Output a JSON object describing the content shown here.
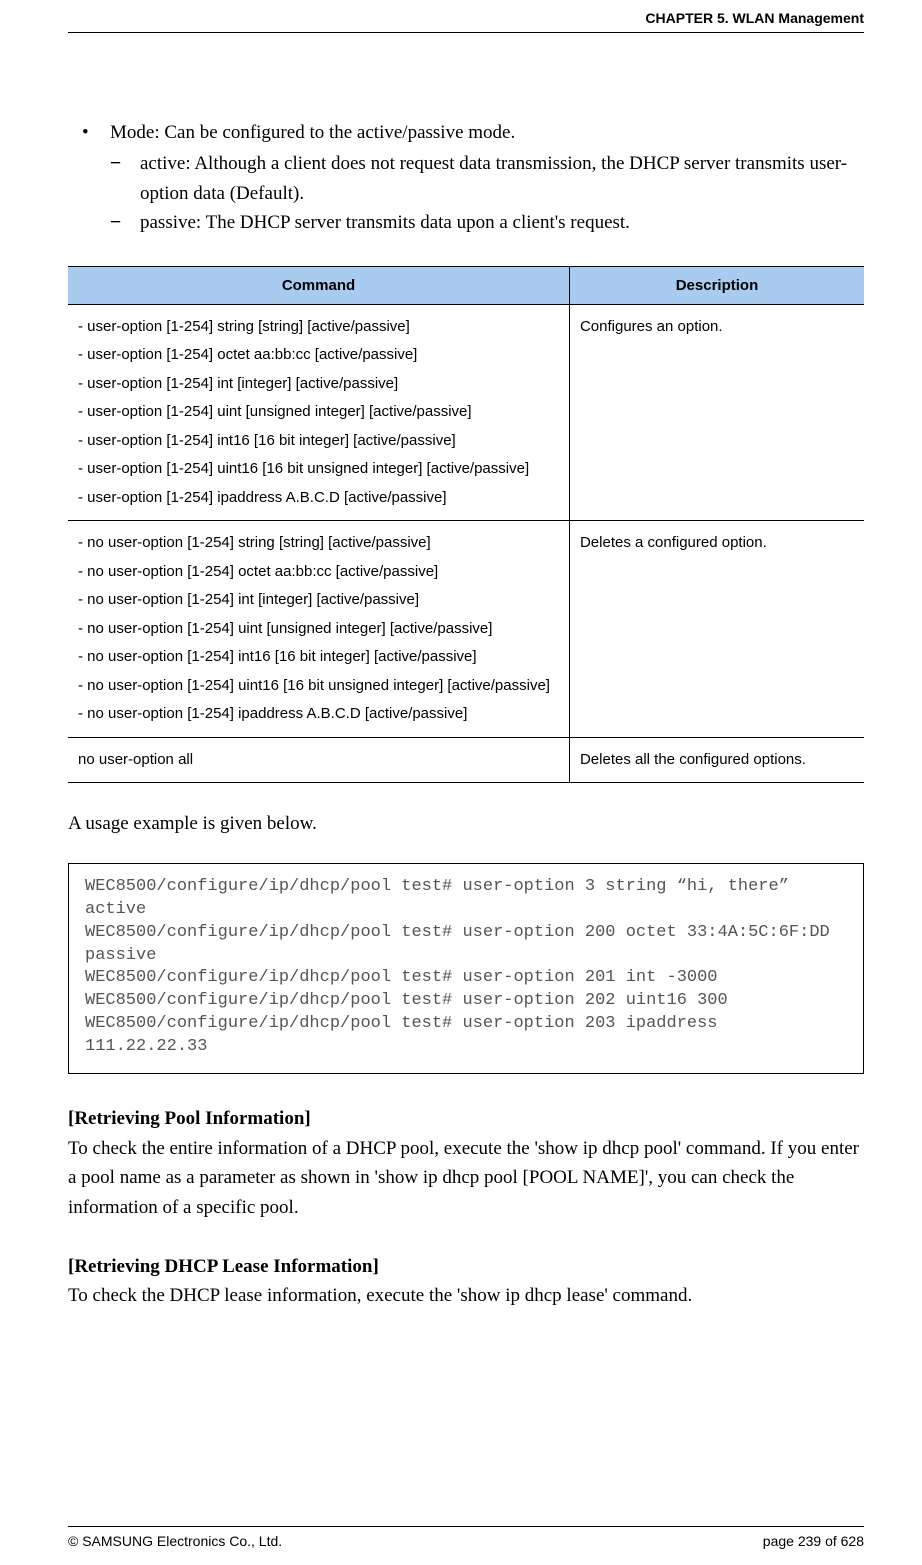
{
  "header": {
    "chapter": "CHAPTER 5. WLAN Management"
  },
  "bullets": {
    "mode": "Mode: Can be configured to the active/passive mode.",
    "sub_active": "active: Although a client does not request data transmission, the DHCP server transmits user-option data (Default).",
    "sub_passive": "passive: The DHCP server transmits data upon a client's request.",
    "dot": "•",
    "dash": "−"
  },
  "table": {
    "head_cmd": "Command",
    "head_desc": "Description",
    "rows": [
      {
        "cmds": [
          "- user-option [1-254] string [string] [active/passive]",
          "- user-option [1-254] octet aa:bb:cc [active/passive]",
          "- user-option [1-254] int [integer] [active/passive]",
          "- user-option [1-254] uint [unsigned integer] [active/passive]",
          "- user-option [1-254] int16 [16 bit integer] [active/passive]",
          "- user-option [1-254] uint16 [16 bit unsigned integer] [active/passive]",
          "- user-option [1-254] ipaddress A.B.C.D [active/passive]"
        ],
        "desc": "Configures an option."
      },
      {
        "cmds": [
          "- no user-option [1-254] string [string] [active/passive]",
          "- no user-option [1-254] octet aa:bb:cc [active/passive]",
          "- no user-option [1-254] int [integer] [active/passive]",
          "- no user-option [1-254] uint [unsigned integer] [active/passive]",
          "- no user-option [1-254] int16 [16 bit integer] [active/passive]",
          "- no user-option [1-254] uint16 [16 bit unsigned integer] [active/passive]",
          "- no user-option [1-254] ipaddress A.B.C.D [active/passive]"
        ],
        "desc": "Deletes a configured option."
      },
      {
        "cmds": [
          "no user-option all"
        ],
        "desc": "Deletes all the configured options."
      }
    ]
  },
  "usage_intro": "A usage example is given below.",
  "code": "WEC8500/configure/ip/dhcp/pool test# user-option 3 string “hi, there” active\nWEC8500/configure/ip/dhcp/pool test# user-option 200 octet 33:4A:5C:6F:DD passive\nWEC8500/configure/ip/dhcp/pool test# user-option 201 int -3000\nWEC8500/configure/ip/dhcp/pool test# user-option 202 uint16 300\nWEC8500/configure/ip/dhcp/pool test# user-option 203 ipaddress 111.22.22.33",
  "sections": {
    "pool_head": "[Retrieving Pool Information]",
    "pool_body": "To check the entire information of a DHCP pool, execute the 'show ip dhcp pool' command. If you enter a pool name as a parameter as shown in 'show ip dhcp pool [POOL NAME]', you can check the information of a specific pool.",
    "lease_head": "[Retrieving DHCP Lease Information]",
    "lease_body": "To check the DHCP lease information, execute the 'show ip dhcp lease' command."
  },
  "footer": {
    "copyright": "© SAMSUNG Electronics Co., Ltd.",
    "page": "page 239 of 628"
  }
}
